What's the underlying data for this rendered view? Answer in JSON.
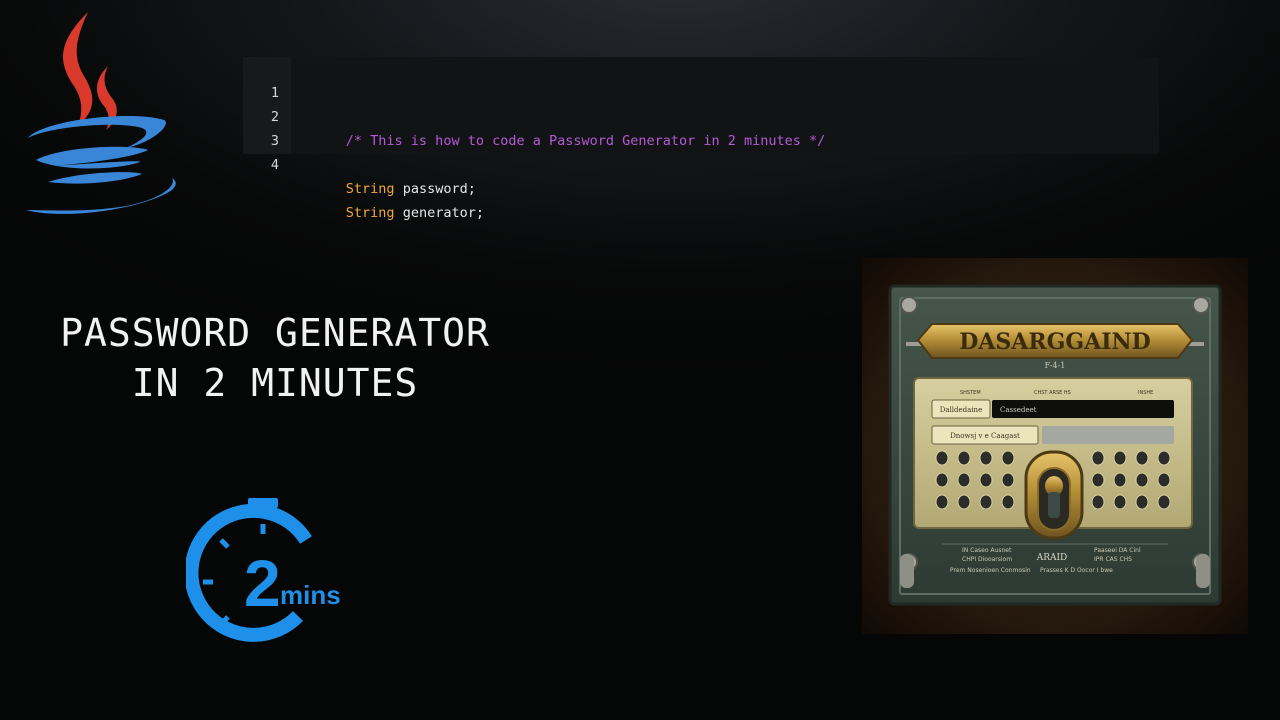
{
  "code_editor": {
    "lines": [
      {
        "number": "1",
        "comment": "/* This is how to code a Password Generator in 2 minutes */",
        "type": "",
        "ident": ""
      },
      {
        "number": "2",
        "comment": "",
        "type": "",
        "ident": ""
      },
      {
        "number": "3",
        "comment": "",
        "type": "String",
        "ident": " password;"
      },
      {
        "number": "4",
        "comment": "",
        "type": "String",
        "ident": " generator;"
      }
    ]
  },
  "title": {
    "line1": "PASSWORD GENERATOR",
    "line2": "IN 2 MINUTES"
  },
  "timer_badge": {
    "number": "2",
    "unit": "mins"
  },
  "illustration": {
    "plate_text": "DASARGGAIND",
    "plate_subtext": "F-4-1",
    "header_labels": [
      "SHSTEM",
      "CHST ARSE HS",
      "INSHE"
    ],
    "field_labels": [
      "Dalldedaine",
      "Cassedeet",
      "Dnowsj v e Caagast"
    ],
    "footer_left": [
      "IN   Caseo Ausnet",
      "CHPI Diooarsiom",
      "Prem Nosenioen Conmosin"
    ],
    "footer_center": "ARAID",
    "footer_right": [
      "Paaseei  DA Cinl",
      "IPR  CAS CHS",
      "Prasses K  D  Oocor I bwe"
    ]
  },
  "colors": {
    "java_red": "#d93a2c",
    "java_blue": "#3a86d6",
    "timer_blue": "#1e90ea",
    "comment": "#b45ad6",
    "keyword": "#f0a73a"
  }
}
